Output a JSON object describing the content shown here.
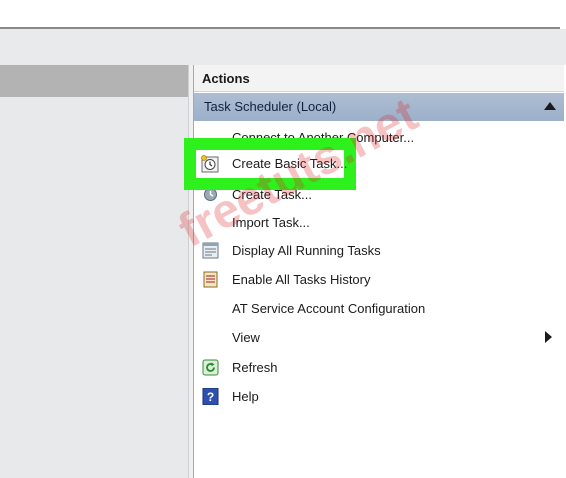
{
  "actions_pane": {
    "title": "Actions",
    "section_title": "Task Scheduler (Local)",
    "items": [
      {
        "label": "Connect to Another Computer...",
        "icon": "none"
      },
      {
        "label": "Create Basic Task...",
        "icon": "task-clock-icon"
      },
      {
        "label": "Create Task...",
        "icon": "task-icon"
      },
      {
        "label": "Import Task...",
        "icon": "none"
      },
      {
        "label": "Display All Running Tasks",
        "icon": "running-tasks-icon"
      },
      {
        "label": "Enable All Tasks History",
        "icon": "tasks-history-icon"
      },
      {
        "label": "AT Service Account Configuration",
        "icon": "none"
      },
      {
        "label": "View",
        "icon": "none",
        "has_submenu": true
      },
      {
        "label": "Refresh",
        "icon": "refresh-icon"
      },
      {
        "label": "Help",
        "icon": "help-icon"
      }
    ]
  },
  "highlight_color": "#2ef01d",
  "section_header_color": "#a6b7ce",
  "watermark": "freetuts.net"
}
